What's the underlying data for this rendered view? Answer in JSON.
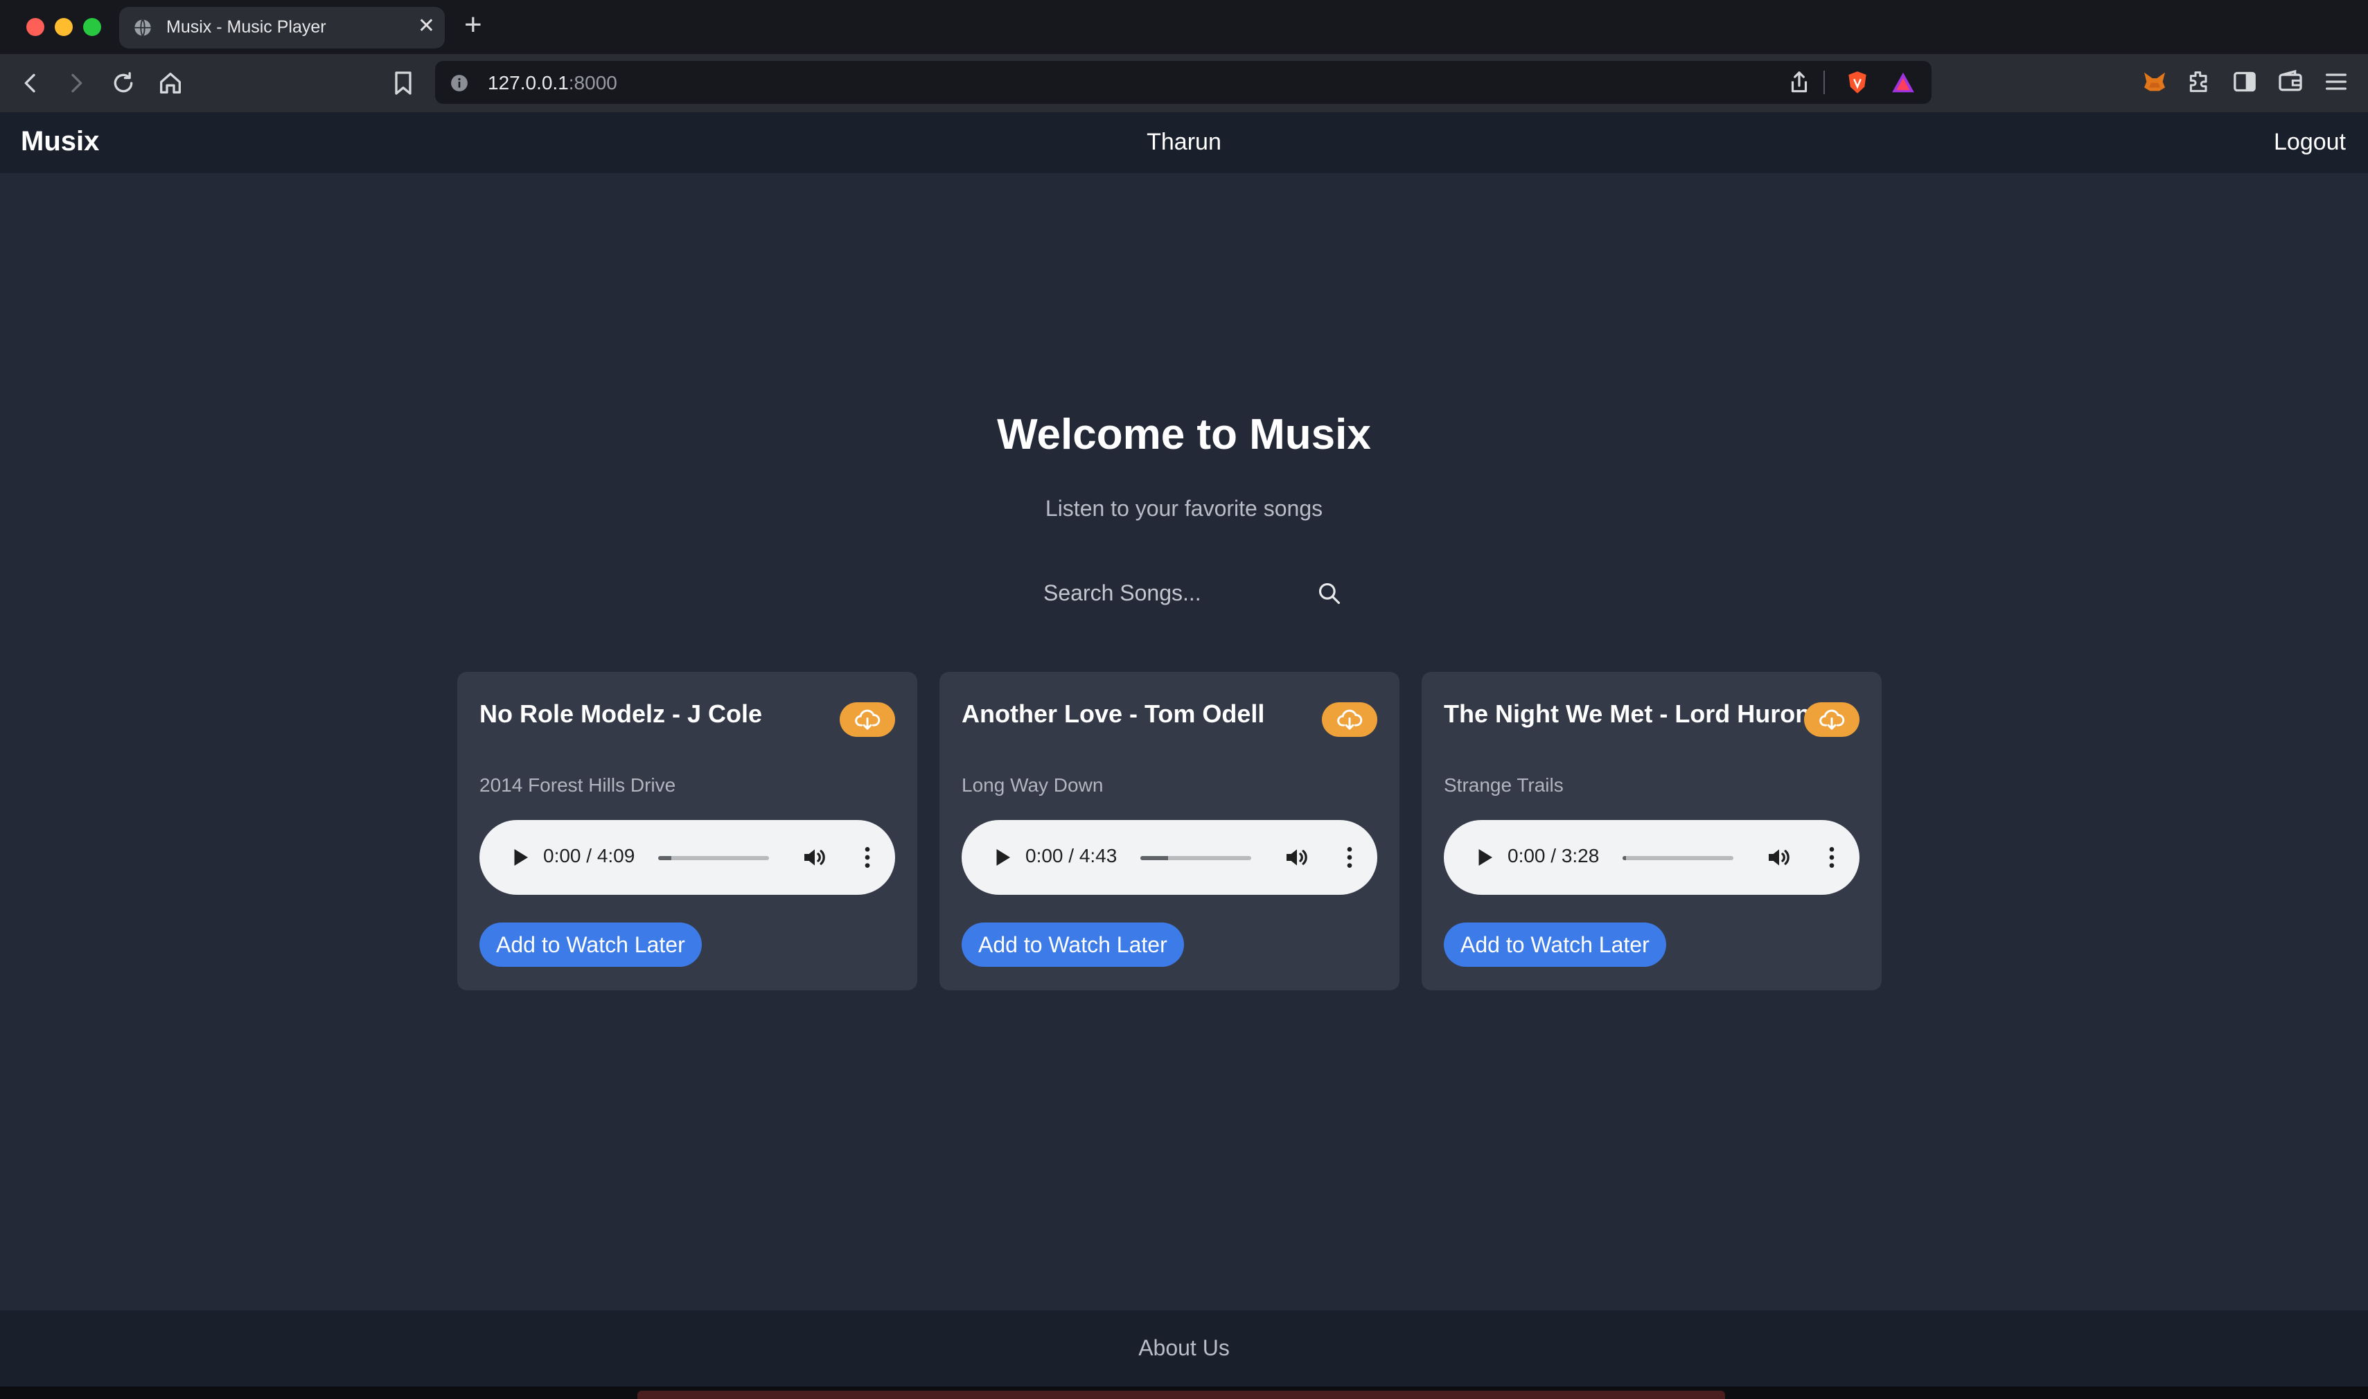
{
  "browser": {
    "tab_title": "Musix - Music Player",
    "new_tab_label": "+",
    "close_label": "✕",
    "url_host": "127.0.0.1",
    "url_port": ":8000"
  },
  "nav": {
    "brand": "Musix",
    "user": "Tharun",
    "logout": "Logout"
  },
  "hero": {
    "title": "Welcome to Musix",
    "subtitle": "Listen to your favorite songs"
  },
  "search": {
    "placeholder": "Search Songs...",
    "value": ""
  },
  "songs": [
    {
      "title": "No Role Modelz - J Cole",
      "album": "2014 Forest Hills Drive",
      "time": "0:00 / 4:09",
      "progress": 0.12,
      "button": "Add to Watch Later"
    },
    {
      "title": "Another Love - Tom Odell",
      "album": "Long Way Down",
      "time": "0:00 / 4:43",
      "progress": 0.25,
      "button": "Add to Watch Later"
    },
    {
      "title": "The Night We Met - Lord Huron",
      "album": "Strange Trails",
      "time": "0:00 / 3:28",
      "progress": 0.03,
      "button": "Add to Watch Later"
    }
  ],
  "footer": {
    "about": "About Us"
  },
  "colors": {
    "page_bg": "#242938",
    "navbar_bg": "#1a1f2c",
    "card_bg": "#353a49",
    "download_accent": "#f0a23a",
    "button_blue": "#3d7be8"
  },
  "icons": [
    "globe-icon",
    "back-icon",
    "forward-icon",
    "reload-icon",
    "home-icon",
    "bookmark-icon",
    "info-icon",
    "share-icon",
    "brave-shield-icon",
    "brave-rewards-icon",
    "metamask-icon",
    "extensions-icon",
    "sidebar-icon",
    "wallet-icon",
    "menu-icon",
    "search-icon",
    "cloud-download-icon",
    "play-icon",
    "volume-icon",
    "more-options-icon"
  ]
}
